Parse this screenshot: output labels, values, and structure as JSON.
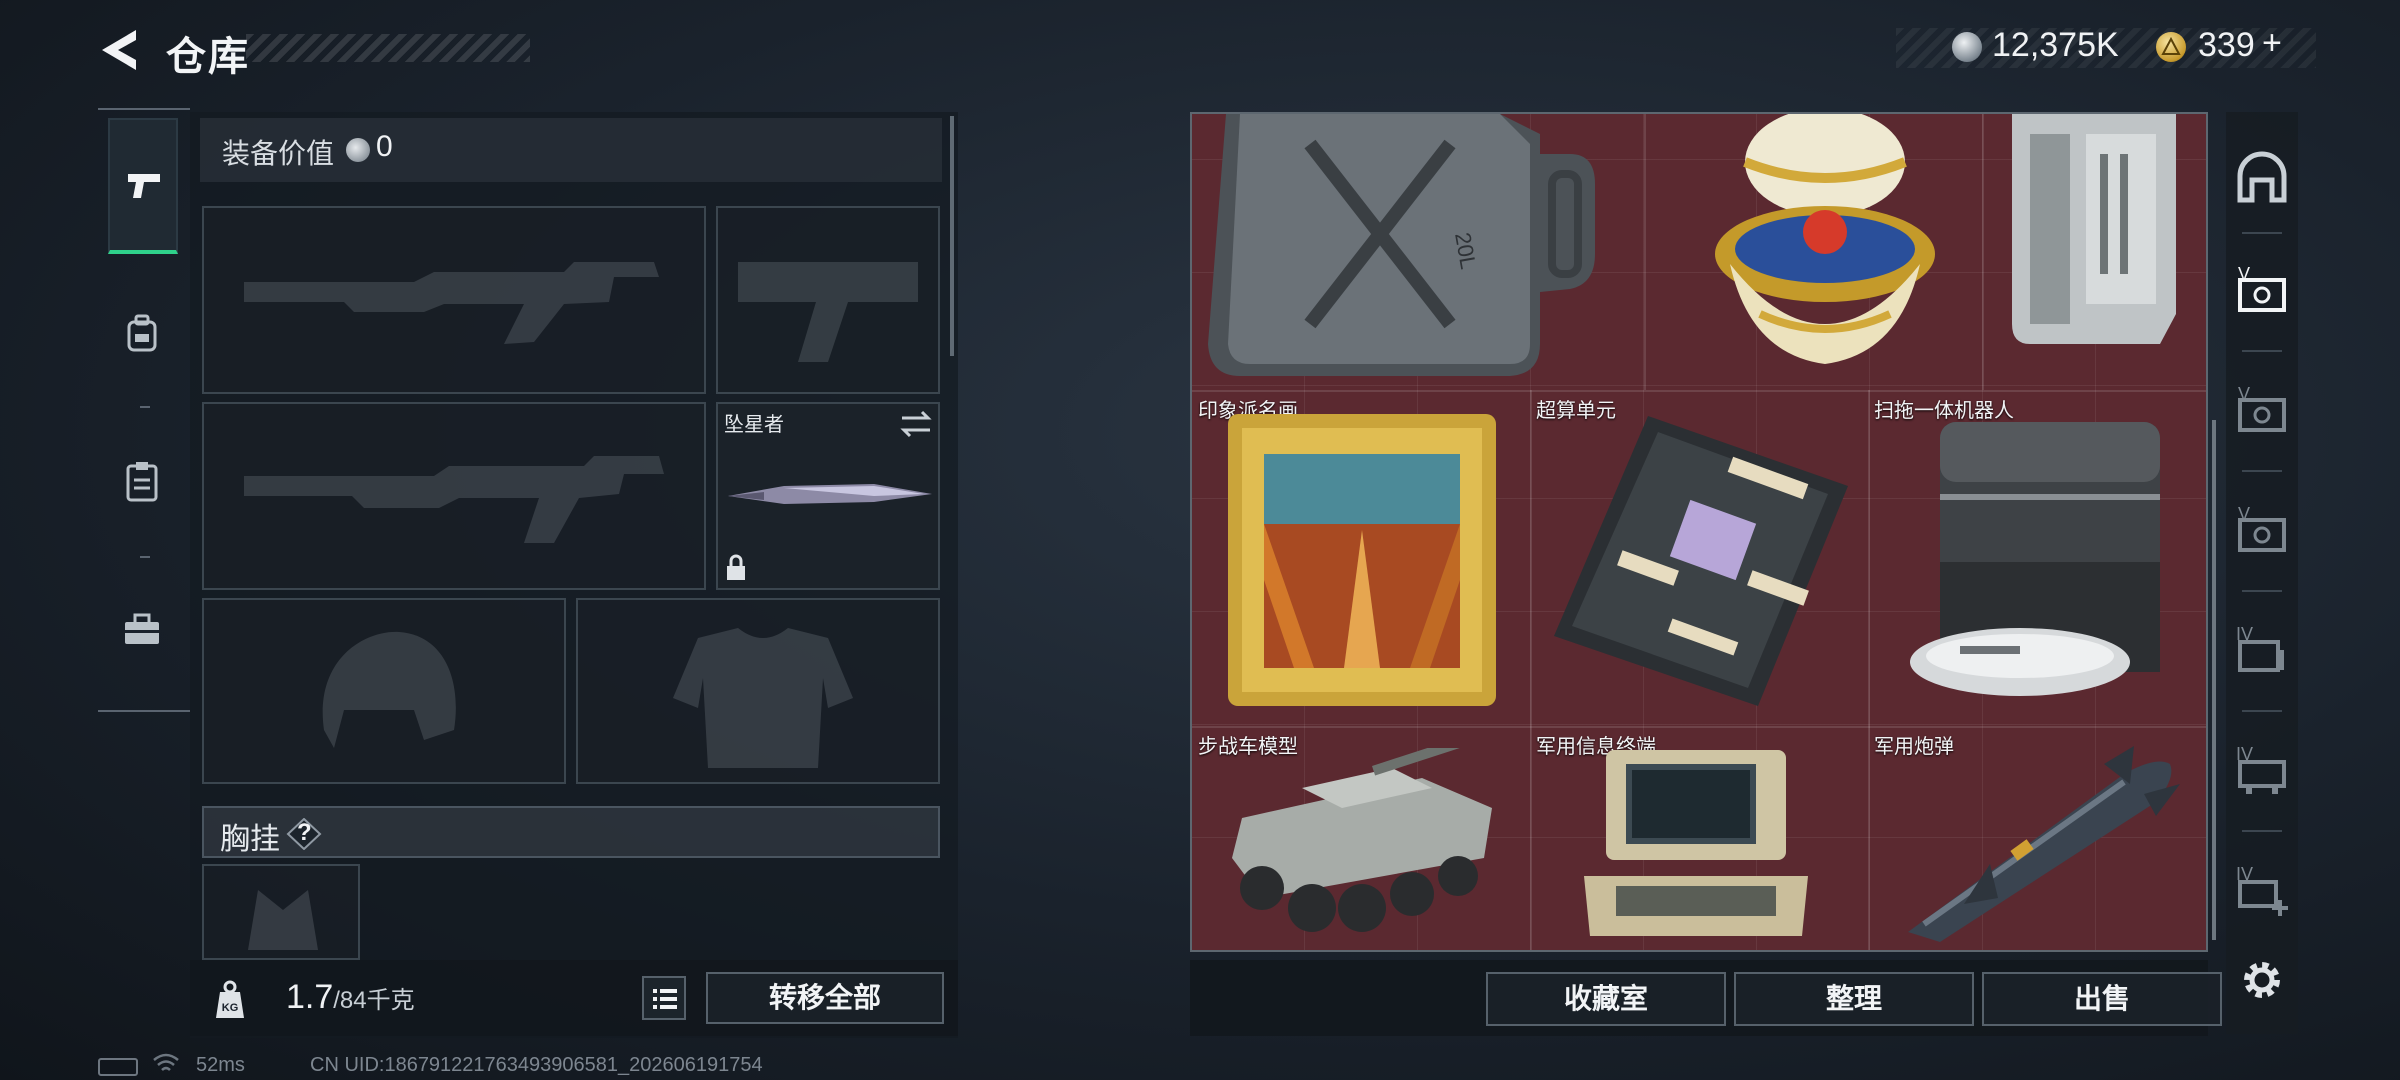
{
  "header": {
    "title": "仓库",
    "currency_primary": "12,375K",
    "currency_secondary": "339",
    "currency_add": "+"
  },
  "loadout": {
    "equip_value_label": "装备价值",
    "equip_value": "0",
    "melee_slot_label": "坠星者",
    "chest_label": "胸挂",
    "chest_help": "?",
    "weight_current": "1.7",
    "weight_max": "/84千克",
    "transfer_all": "转移全部"
  },
  "storage": {
    "items": [
      {
        "label": "印象派名画"
      },
      {
        "label": "超算单元"
      },
      {
        "label": "扫拖一体机器人"
      },
      {
        "label": "步战车模型"
      },
      {
        "label": "军用信息终端"
      },
      {
        "label": "军用炮弹"
      }
    ],
    "jerrycan_text": "20L",
    "buttons": {
      "collection": "收藏室",
      "sort": "整理",
      "sell": "出售"
    }
  },
  "rail": {
    "tier_labels": [
      "V",
      "V",
      "V",
      "IV",
      "IV",
      "IV"
    ]
  },
  "status": {
    "ping": "52ms",
    "uid": "CN UID:1867912217634939065​81_202606191754"
  },
  "colors": {
    "accent_green": "#2fd18b",
    "grid_background": "#5b2930",
    "panel_border": "#56616b"
  }
}
